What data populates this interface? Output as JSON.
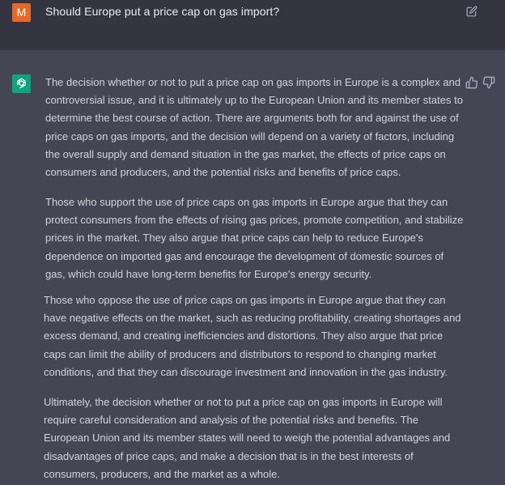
{
  "user_message": {
    "avatar_letter": "M",
    "text": "Should Europe put a price cap on gas import?",
    "avatar_color": "#e4692a"
  },
  "assistant_message": {
    "avatar_color": "#10a37f",
    "paragraphs": [
      "The decision whether or not to put a price cap on gas imports in Europe is a complex and controversial issue, and it is ultimately up to the European Union and its member states to determine the best course of action. There are arguments both for and against the use of price caps on gas imports, and the decision will depend on a variety of factors, including the overall supply and demand situation in the gas market, the effects of price caps on consumers and producers, and the potential risks and benefits of price caps.",
      "Those who support the use of price caps on gas imports in Europe argue that they can protect consumers from the effects of rising gas prices, promote competition, and stabilize prices in the market. They also argue that price caps can help to reduce Europe's dependence on imported gas and encourage the development of domestic sources of gas, which could have long-term benefits for Europe's energy security.",
      "Those who oppose the use of price caps on gas imports in Europe argue that they can have negative effects on the market, such as reducing profitability, creating shortages and excess demand, and creating inefficiencies and distortions. They also argue that price caps can limit the ability of producers and distributors to respond to changing market conditions, and that they can discourage investment and innovation in the gas industry.",
      "Ultimately, the decision whether or not to put a price cap on gas imports in Europe will require careful consideration and analysis of the potential risks and benefits. The European Union and its member states will need to weigh the potential advantages and disadvantages of price caps, and make a decision that is in the best interests of consumers, producers, and the market as a whole."
    ]
  },
  "icons": {
    "edit": "edit-icon",
    "thumbs_up": "thumbs-up-icon",
    "thumbs_down": "thumbs-down-icon",
    "assistant_logo": "openai-logo-icon"
  },
  "colors": {
    "user_row_bg": "#343541",
    "assistant_row_bg": "#444654",
    "text": "#d1d5db"
  }
}
